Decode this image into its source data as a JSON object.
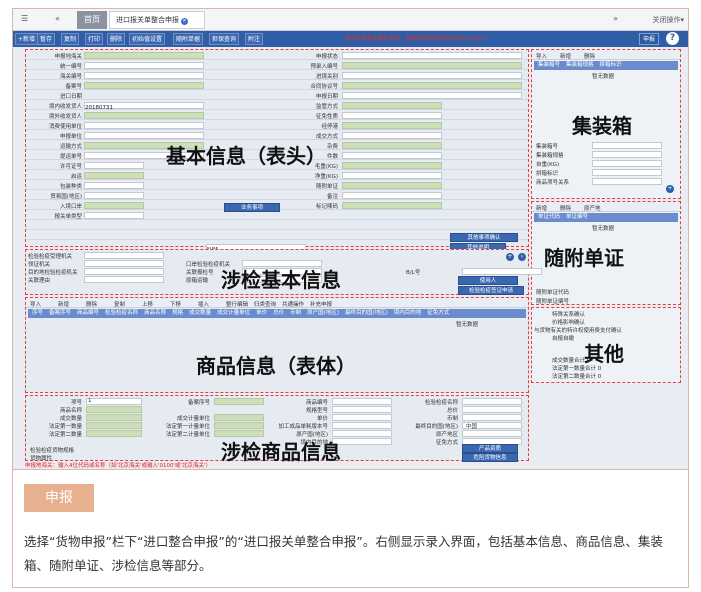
{
  "topbar": {
    "menu_icon": "☰",
    "back_icon": "«",
    "home_tab": "首页",
    "doc_tab": "进口报关单整合申报",
    "forward_icon": "»",
    "close_ops": "关闭操作▾"
  },
  "toolbar": {
    "buttons": [
      "+新增",
      "暂存",
      "复制",
      "打印",
      "删除",
      "初始值设置",
      "随附单据",
      "担保查询",
      "附注"
    ],
    "notice": "请先获取报关报检单证，具体请调用信息查询http://www",
    "submit": "申报",
    "help": "?"
  },
  "basic": {
    "section_title": "基本信息（表头）",
    "labels": [
      "申报地海关",
      "统一编号",
      "海关编号",
      "备案号",
      "进口日期",
      "境内收发货人",
      "境外收发货人",
      "消费使用单位",
      "申报单位",
      "运输方式",
      "提运单号",
      "许可证号",
      "启运",
      "包装种类",
      "贸易国(地区)",
      "入境口岸",
      "报关单类型"
    ],
    "right_labels": [
      "申报状态",
      "预录入编号",
      "进境关别",
      "合同协议号",
      "申报日期",
      "监管方式",
      "征免性质",
      "经停港",
      "成交方式",
      "杂费",
      "件数",
      "毛重(KG)",
      "净重(KG)",
      "随附单证",
      "备注",
      "标记唛码"
    ],
    "import_date": "20180731",
    "nm": "N/M",
    "btn_other": "其他事项确认",
    "btn_business": "业务事项",
    "btn_search": "其他说明"
  },
  "container": {
    "title": "集装箱",
    "toolbar": [
      "导入",
      "新增",
      "删除"
    ],
    "cols": [
      "集装箱号",
      "集装箱规格",
      "拼箱标识"
    ],
    "empty": "暂无数据",
    "fields": [
      "集装箱号",
      "集装箱规格",
      "自重(KG)",
      "拼箱标识",
      "商品项号关系"
    ]
  },
  "attached": {
    "title": "随附单证",
    "toolbar": [
      "新增",
      "删除",
      "原产地"
    ],
    "cols": [
      "单证代码",
      "单证编号"
    ],
    "empty": "暂无数据",
    "fields": [
      "随附单证代码",
      "随附单证编号"
    ]
  },
  "inspection": {
    "title": "涉检基本信息",
    "labels": [
      "检验检疫受理机关",
      "领证机关",
      "口岸检验检疫机关",
      "目的地检验检疫机关",
      "关联报检号",
      "B/L号",
      "关联理由",
      "原箱运输"
    ],
    "btn_user": "使用人",
    "btn_check": "检验检疫签证申请"
  },
  "goods": {
    "title": "商品信息（表体）",
    "toolbar": [
      "导入",
      "新增",
      "删除",
      "复制",
      "上移",
      "下移",
      "插入",
      "整行编辑",
      "归类查询",
      "共通操作",
      "补充申报"
    ],
    "cols": [
      "序号",
      "备案序号",
      "商品编号",
      "检验检疫名称",
      "商品名称",
      "规格",
      "成交数量",
      "成交计量单位",
      "单价",
      "总价",
      "币制",
      "原产国(地区)",
      "最终目的国(地区)",
      "境内目的地",
      "征免方式"
    ],
    "empty": "暂无数据",
    "field_labels": [
      "项号",
      "商品名称",
      "成交数量",
      "法定第一数量",
      "法定第二数量"
    ],
    "mid_labels": [
      "备案序号",
      "成交计量单位",
      "法定第一计量单位",
      "法定第二计量单位"
    ],
    "right_labels": [
      "商品编号",
      "规格型号",
      "单价",
      "加工成品单耗版本号",
      "原产国(地区)",
      "境内目的地"
    ],
    "far_labels": [
      "检验检疫名称",
      "总价",
      "币制",
      "最终目的国(地区)",
      "原产地区",
      "征免方式"
    ],
    "item_no": "1",
    "country": "中国"
  },
  "other": {
    "title": "其他",
    "fields": [
      "特殊关系确认",
      "价格影响确认",
      "与货物有关的特许权使用费支付确认",
      "自报自缴"
    ],
    "summary": [
      "成交数量合计 0",
      "法定第一数量合计 0",
      "法定第二数量合计 0"
    ]
  },
  "insp_goods": {
    "title": "涉检商品信息",
    "labels": [
      "检验检疫货物规格",
      "货物属性"
    ],
    "btn_product": "产品资质",
    "btn_goods": "危险货物信息"
  },
  "footer_note": "申报地海关：输入4位代码或名称（如'北京海关'或输入'0100'或'北京海关'）",
  "caption": {
    "title": "申报",
    "text": "选择“货物申报”栏下“进口整合申报”的“进口报关单整合申报”。右侧显示录入界面，包括基本信息、商品信息、集装箱、随附单证、涉检信息等部分。"
  },
  "colors": {
    "toolbar": "#2f5da6",
    "accent_red": "#e04040",
    "caption_bg": "#e7b08e",
    "field_green": "#cde0b8"
  }
}
